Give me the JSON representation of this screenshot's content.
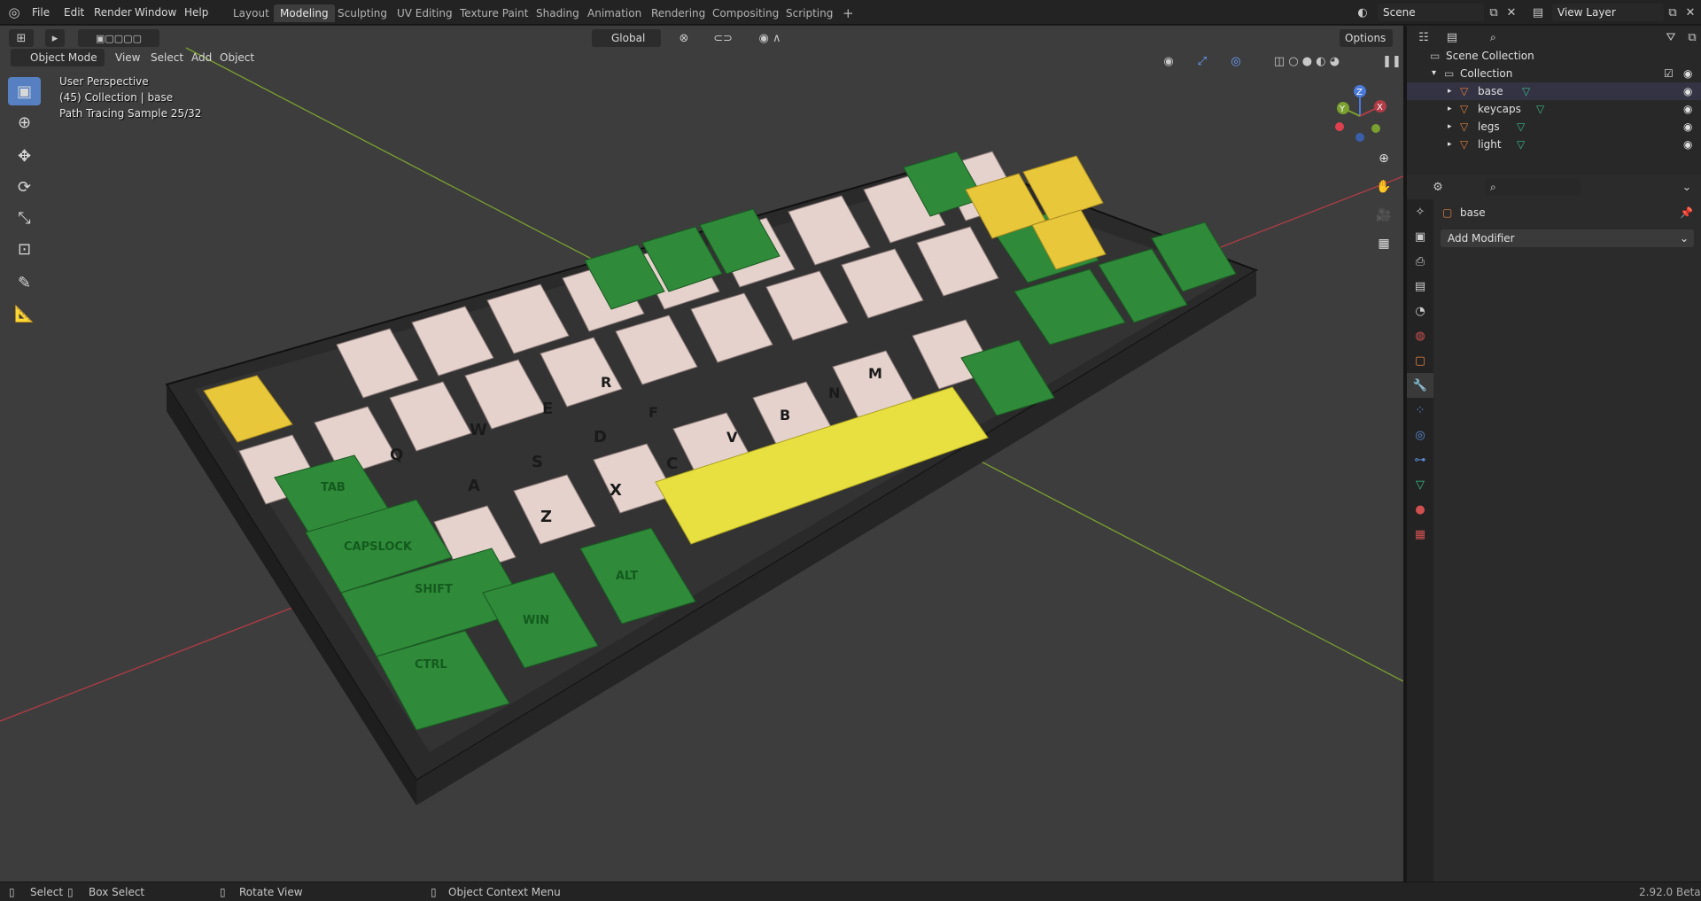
{
  "top_menu": {
    "file": "File",
    "edit": "Edit",
    "render": "Render",
    "window": "Window",
    "help": "Help"
  },
  "workspaces": [
    "Layout",
    "Modeling",
    "Sculpting",
    "UV Editing",
    "Texture Paint",
    "Shading",
    "Animation",
    "Rendering",
    "Compositing",
    "Scripting"
  ],
  "active_workspace": "Modeling",
  "add_workspace": "+",
  "scene": {
    "name": "Scene"
  },
  "view_layer": {
    "name": "View Layer"
  },
  "viewport_header": {
    "mode": "Object Mode",
    "menus": [
      "View",
      "Select",
      "Add",
      "Object"
    ],
    "orientation": "Global",
    "options": "Options"
  },
  "overlay": {
    "perspective": "User Perspective",
    "collection": "(45) Collection | base",
    "render_status": "Path Tracing Sample 25/32"
  },
  "gizmo": {
    "x": "X",
    "y": "Y",
    "z": "Z"
  },
  "keyboard_labels": [
    "TAB",
    "CAPSLOCK",
    "SHIFT",
    "CTRL",
    "WIN",
    "ALT",
    "Q",
    "W",
    "E",
    "R",
    "A",
    "S",
    "D",
    "F",
    "Z",
    "X",
    "C",
    "V",
    "B",
    "N",
    "M"
  ],
  "outliner": {
    "root": "Scene Collection",
    "collection": "Collection",
    "objects": [
      {
        "name": "base"
      },
      {
        "name": "keycaps"
      },
      {
        "name": "legs"
      },
      {
        "name": "light"
      }
    ]
  },
  "properties": {
    "object_name": "base",
    "add_modifier": "Add Modifier"
  },
  "statusbar": {
    "select": "Select",
    "box_select": "Box Select",
    "rotate_view": "Rotate View",
    "context_menu": "Object Context Menu",
    "version": "2.92.0 Beta"
  },
  "colors": {
    "keycap_white": "#e6d2cc",
    "keycap_green": "#2f8a3a",
    "keycap_yellow": "#e8c83a",
    "case": "#2a2a2a",
    "axis_red": "#b03c46",
    "axis_green": "#7aa030",
    "active_blue": "#5680c2"
  }
}
